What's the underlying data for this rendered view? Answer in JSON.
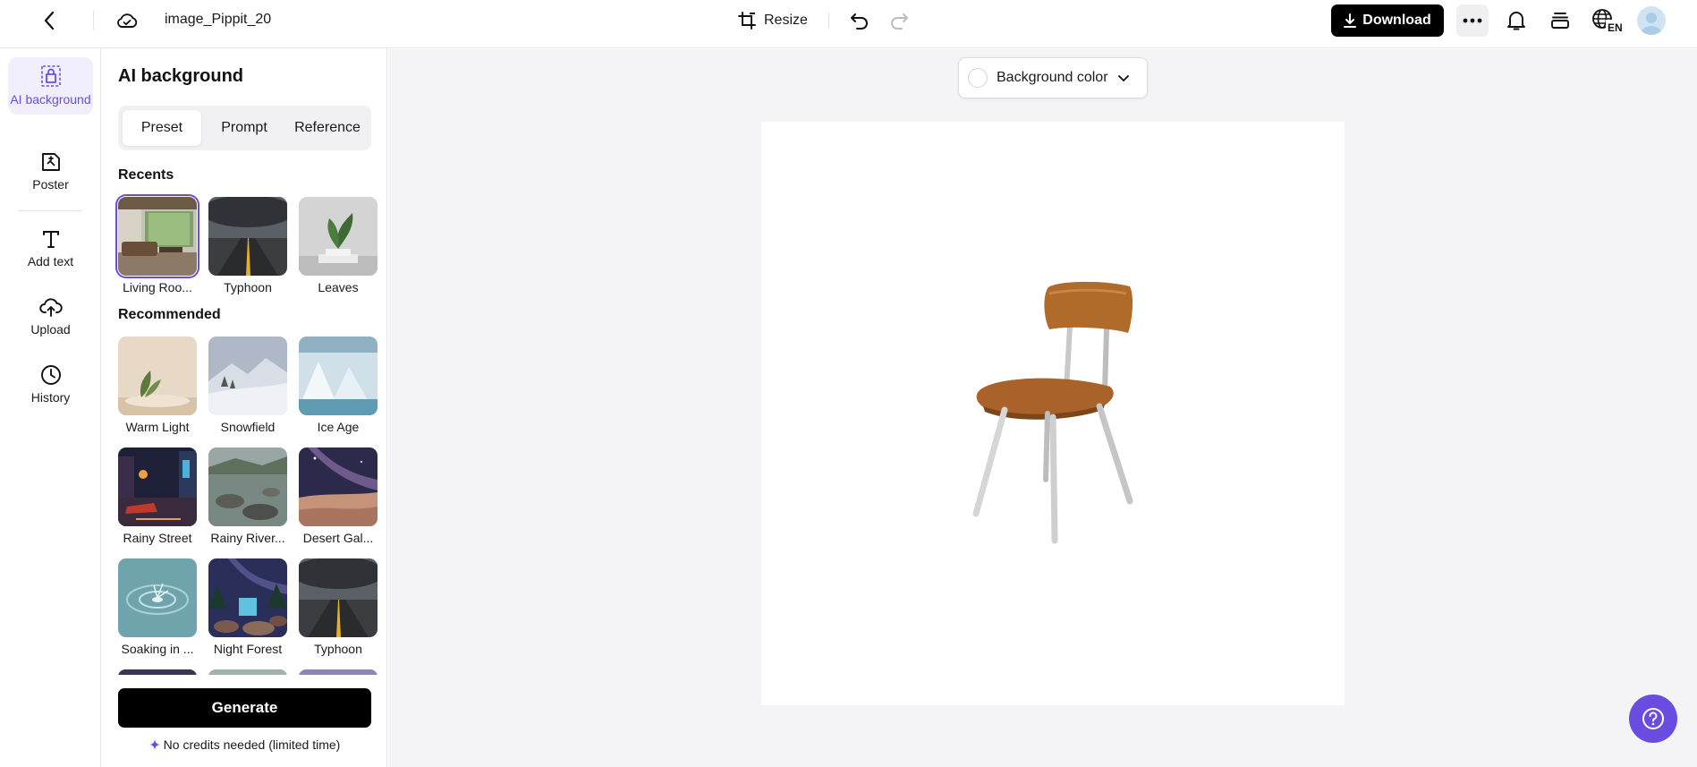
{
  "header": {
    "title": "image_Pippit_20",
    "resize_label": "Resize",
    "download_label": "Download",
    "lang_code": "EN"
  },
  "rail": {
    "items": [
      {
        "label": "AI background",
        "icon": "ai-background-icon",
        "active": true
      },
      {
        "label": "Poster",
        "icon": "poster-icon"
      },
      {
        "label": "Add text",
        "icon": "text-icon"
      },
      {
        "label": "Upload",
        "icon": "upload-icon"
      },
      {
        "label": "History",
        "icon": "history-icon"
      }
    ]
  },
  "panel": {
    "title": "AI background",
    "tabs": [
      {
        "label": "Preset",
        "active": true
      },
      {
        "label": "Prompt"
      },
      {
        "label": "Reference"
      }
    ],
    "recents_label": "Recents",
    "recents": [
      {
        "label": "Living Roo..."
      },
      {
        "label": "Typhoon"
      },
      {
        "label": "Leaves"
      }
    ],
    "recommended_label": "Recommended",
    "recommended": [
      {
        "label": "Warm Light"
      },
      {
        "label": "Snowfield"
      },
      {
        "label": "Ice Age"
      },
      {
        "label": "Rainy Street"
      },
      {
        "label": "Rainy River..."
      },
      {
        "label": "Desert Gal..."
      },
      {
        "label": "Soaking in ..."
      },
      {
        "label": "Night Forest"
      },
      {
        "label": "Typhoon"
      }
    ],
    "generate_label": "Generate",
    "credits_note": "No credits needed (limited time)"
  },
  "canvas": {
    "background_color_label": "Background color"
  },
  "colors": {
    "accent": "#6a4de0",
    "primary_button": "#000000",
    "workspace": "#f4f4f6"
  }
}
